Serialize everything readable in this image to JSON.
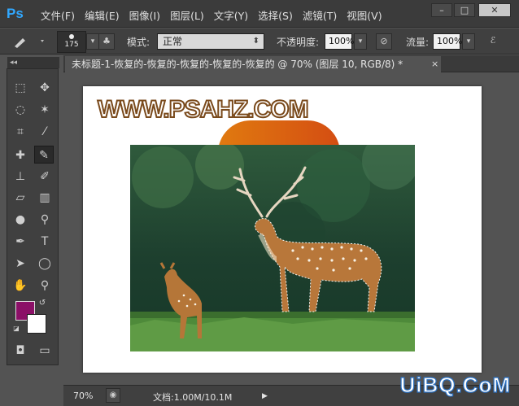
{
  "app": {
    "logo": "Ps"
  },
  "menu": [
    "文件(F)",
    "编辑(E)",
    "图像(I)",
    "图层(L)",
    "文字(Y)",
    "选择(S)",
    "滤镜(T)",
    "视图(V)"
  ],
  "window_controls": {
    "minimize": "–",
    "maximize": "□",
    "close": "✕"
  },
  "options": {
    "brush_size": "175",
    "mode_label": "模式:",
    "mode_value": "正常",
    "opacity_label": "不透明度:",
    "opacity_value": "100%",
    "flow_label": "流量:",
    "flow_value": "100%"
  },
  "toolbox_header": "◂◂",
  "document": {
    "tab_title": "未标题-1-恢复的-恢复的-恢复的-恢复的-恢复的 @ 70% (图层 10, RGB/8) *",
    "tab_close": "×",
    "watermark": "WWW.PSAHZ.COM"
  },
  "colors": {
    "foreground": "#8b1067",
    "background": "#ffffff"
  },
  "status": {
    "zoom": "70%",
    "doc_size": "文档:1.00M/10.1M",
    "arrow": "▶"
  },
  "corner_logo": "UiBQ.CoM",
  "tools": [
    "rect-marquee-icon",
    "move-icon",
    "lasso-icon",
    "magic-wand-icon",
    "crop-icon",
    "eyedropper-icon",
    "healing-brush-icon",
    "brush-icon",
    "clone-stamp-icon",
    "history-brush-icon",
    "eraser-icon",
    "gradient-icon",
    "blur-icon",
    "dodge-icon",
    "pen-icon",
    "type-icon",
    "path-select-icon",
    "ellipse-icon",
    "hand-icon",
    "zoom-icon"
  ]
}
